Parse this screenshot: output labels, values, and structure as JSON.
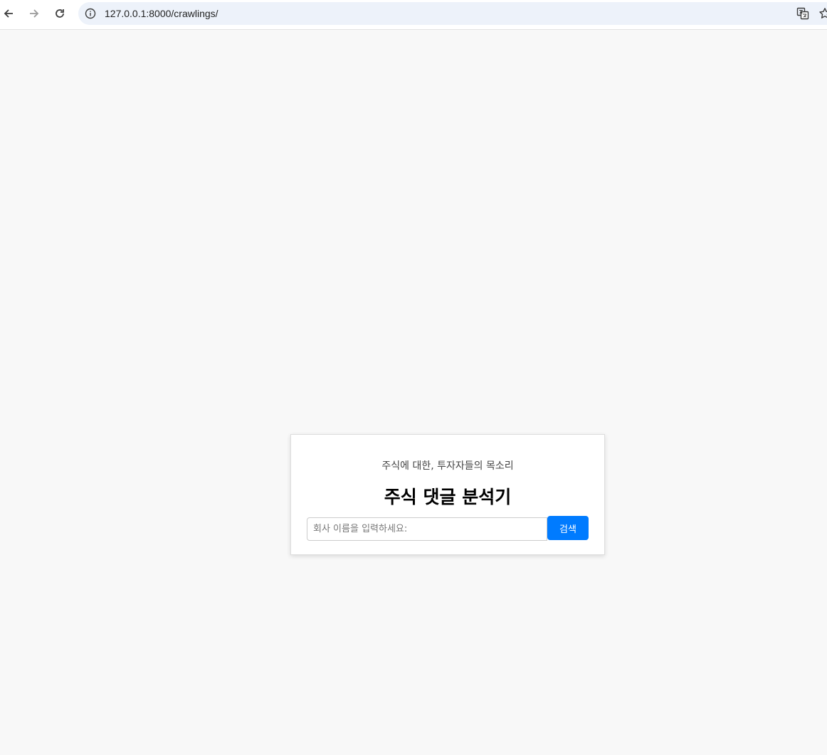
{
  "browser": {
    "url": "127.0.0.1:8000/crawlings/",
    "icons": {
      "back": "arrow-left-icon",
      "forward": "arrow-right-icon",
      "reload": "reload-icon",
      "site_info": "info-icon",
      "translate": "translate-icon",
      "bookmark": "star-icon"
    }
  },
  "card": {
    "subtitle": "주식에 대한, 투자자들의 목소리",
    "title": "주식 댓글 분석기",
    "search": {
      "placeholder": "회사 이름을 입력하세요:",
      "value": "",
      "button_label": "검색"
    }
  },
  "colors": {
    "page_background": "#f8f8f8",
    "accent": "#007bff",
    "omnibox": "#edf2fa"
  }
}
